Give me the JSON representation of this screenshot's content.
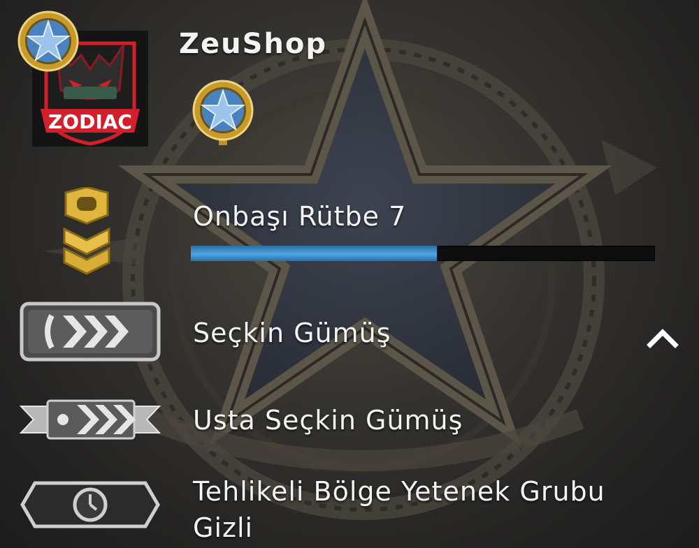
{
  "player": {
    "name": "ZeuShop",
    "avatar_text": "ZODIAC"
  },
  "profile_rank": {
    "title": "Onbaşı Rütbe 7",
    "xp_progress_fraction": 0.53
  },
  "competitive": {
    "rank_label": "Seçkin Gümüş",
    "expand_icon": "chevron-up-icon"
  },
  "wingman": {
    "rank_label": "Usta Seçkin Gümüş"
  },
  "danger_zone": {
    "line1": "Tehlikeli Bölge Yetenek Grubu",
    "line2": "Gizli"
  },
  "colors": {
    "xp_fill": "#4ea6e0",
    "gold": "#d9b24a",
    "silver": "#c8c8c8",
    "avatar_red": "#d21f2b"
  }
}
